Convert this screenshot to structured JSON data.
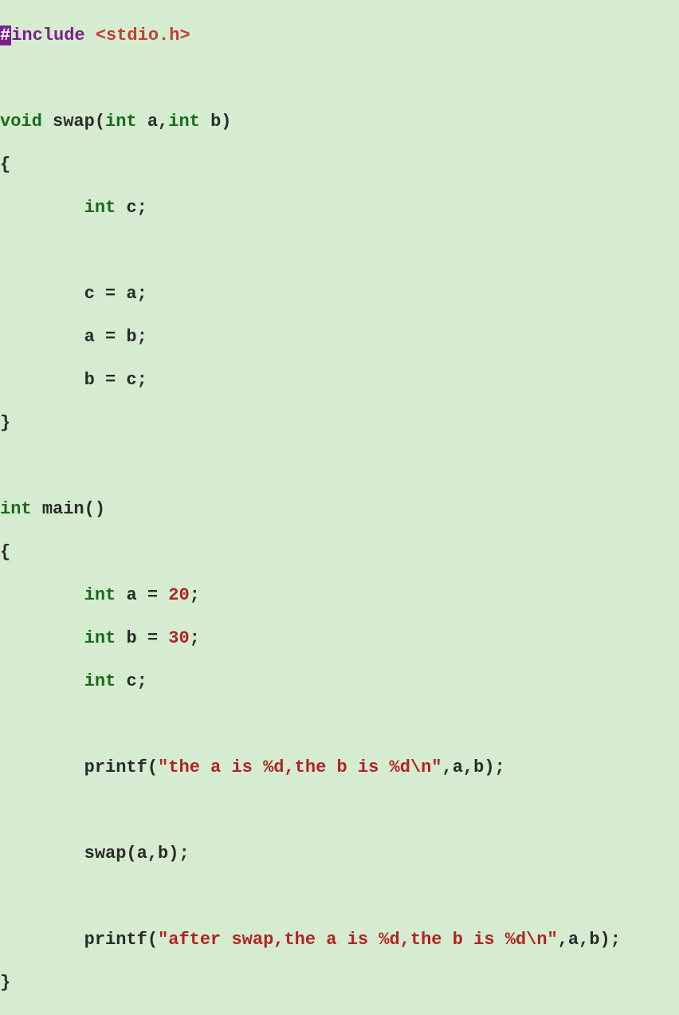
{
  "code": {
    "l1": {
      "hash": "#",
      "include_kw": "include",
      "sp": " ",
      "header": "<stdio.h>"
    },
    "l3": {
      "void_kw": "void",
      "sp1": " ",
      "fn": "swap",
      "paren_o": "(",
      "int1": "int",
      "sp2": " ",
      "a": "a",
      "comma": ",",
      "int2": "int",
      "sp3": " ",
      "b": "b",
      "paren_c": ")"
    },
    "l4": {
      "brace": "{"
    },
    "l5": {
      "indent": "        ",
      "int_kw": "int",
      "sp": " ",
      "c": "c",
      "semi": ";"
    },
    "l7": {
      "indent": "        ",
      "stmt": "c = a;"
    },
    "l8": {
      "indent": "        ",
      "stmt": "a = b;"
    },
    "l9": {
      "indent": "        ",
      "stmt": "b = c;"
    },
    "l10": {
      "brace": "}"
    },
    "l12": {
      "int_kw": "int",
      "sp": " ",
      "fn": "main",
      "parens": "()"
    },
    "l13": {
      "brace": "{"
    },
    "l14": {
      "indent": "        ",
      "int_kw": "int",
      "sp1": " ",
      "var": "a = ",
      "num": "20",
      "semi": ";"
    },
    "l15": {
      "indent": "        ",
      "int_kw": "int",
      "sp1": " ",
      "var": "b = ",
      "num": "30",
      "semi": ";"
    },
    "l16": {
      "indent": "        ",
      "int_kw": "int",
      "sp": " ",
      "c": "c",
      "semi": ";"
    },
    "l18": {
      "indent": "        ",
      "fn": "printf",
      "paren_o": "(",
      "str": "\"the a is %d,the b is %d\\n\"",
      "rest": ",a,b);"
    },
    "l20": {
      "indent": "        ",
      "call": "swap(a,b);"
    },
    "l22": {
      "indent": "        ",
      "fn": "printf",
      "paren_o": "(",
      "str": "\"after swap,the a is %d,the b is %d\\n\"",
      "rest": ",a,b);"
    },
    "l23": {
      "brace": "}"
    }
  }
}
